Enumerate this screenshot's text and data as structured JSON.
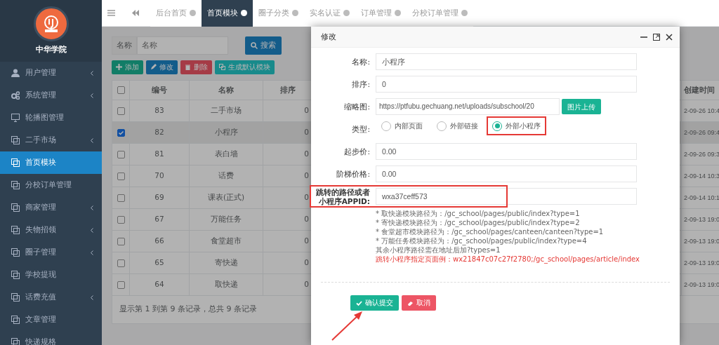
{
  "sidebar": {
    "school_name": "中华学院",
    "items": [
      {
        "label": "用户管理",
        "kind": "user",
        "has_children": true,
        "selected": false
      },
      {
        "label": "系统管理",
        "kind": "gears",
        "has_children": true,
        "selected": false
      },
      {
        "label": "轮播图管理",
        "kind": "monitor",
        "has_children": false,
        "selected": false
      },
      {
        "label": "二手市场",
        "kind": "copy",
        "has_children": true,
        "selected": false
      },
      {
        "label": "首页模块",
        "kind": "copy",
        "has_children": false,
        "selected": true
      },
      {
        "label": "分校订单管理",
        "kind": "copy",
        "has_children": false,
        "selected": false
      },
      {
        "label": "商家管理",
        "kind": "copy",
        "has_children": true,
        "selected": false
      },
      {
        "label": "失物招领",
        "kind": "copy",
        "has_children": true,
        "selected": false
      },
      {
        "label": "圈子管理",
        "kind": "copy",
        "has_children": true,
        "selected": false
      },
      {
        "label": "学校提现",
        "kind": "copy",
        "has_children": false,
        "selected": false
      },
      {
        "label": "话费充值",
        "kind": "copy",
        "has_children": true,
        "selected": false
      },
      {
        "label": "文章管理",
        "kind": "copy",
        "has_children": false,
        "selected": false
      },
      {
        "label": "快递规格",
        "kind": "copy",
        "has_children": false,
        "selected": false
      }
    ]
  },
  "tabs": [
    {
      "label": "后台首页",
      "selected": false
    },
    {
      "label": "首页模块",
      "selected": true
    },
    {
      "label": "圈子分类",
      "selected": false
    },
    {
      "label": "实名认证",
      "selected": false
    },
    {
      "label": "订单管理",
      "selected": false
    },
    {
      "label": "分校订单管理",
      "selected": false
    }
  ],
  "search": {
    "label": "名称",
    "placeholder": "名称",
    "button": "搜索"
  },
  "toolbar": [
    {
      "label": "添加",
      "kind": "add"
    },
    {
      "label": "修改",
      "kind": "edit"
    },
    {
      "label": "删除",
      "kind": "delete"
    },
    {
      "label": "生成默认模块",
      "kind": "generate"
    }
  ],
  "table": {
    "all_checked": false,
    "columns": [
      "编号",
      "名称",
      "排序",
      "创建时间"
    ],
    "rows": [
      {
        "selected": false,
        "cells": [
          "83",
          "二手市场",
          "0",
          "2-09-26 10:4"
        ]
      },
      {
        "selected": true,
        "cells": [
          "82",
          "小程序",
          "0",
          "2-09-26 09:4"
        ]
      },
      {
        "selected": false,
        "cells": [
          "81",
          "表白墙",
          "0",
          "2-09-26 09:3"
        ]
      },
      {
        "selected": false,
        "cells": [
          "70",
          "话费",
          "0",
          "2-09-14 10:3"
        ]
      },
      {
        "selected": false,
        "cells": [
          "69",
          "课表(正式)",
          "0",
          "2-09-14 10:1"
        ]
      },
      {
        "selected": false,
        "cells": [
          "67",
          "万能任务",
          "0",
          "2-09-13 19:0"
        ]
      },
      {
        "selected": false,
        "cells": [
          "66",
          "食堂超市",
          "0",
          "2-09-13 19:0"
        ]
      },
      {
        "selected": false,
        "cells": [
          "65",
          "寄快递",
          "0",
          "2-09-13 19:0"
        ]
      },
      {
        "selected": false,
        "cells": [
          "64",
          "取快递",
          "0",
          "2-09-13 19:0"
        ]
      }
    ],
    "footer": "显示第 1 到第 9 条记录，总共 9 条记录"
  },
  "modal": {
    "title": "修改",
    "fields": [
      {
        "kind": "text",
        "label": "名称:",
        "value": "小程序",
        "highlighted": false
      },
      {
        "kind": "text",
        "label": "排序:",
        "value": "0",
        "highlighted": false
      },
      {
        "kind": "upload",
        "label": "缩略图:",
        "value": "https://ptfubu.gechuang.net/uploads/subschool/20",
        "button": "图片上传",
        "highlighted": false
      },
      {
        "kind": "radio",
        "label": "类型:",
        "options": [
          {
            "label": "内部页面",
            "selected": false,
            "highlighted": false
          },
          {
            "label": "外部链接",
            "selected": false,
            "highlighted": false
          },
          {
            "label": "外部小程序",
            "selected": true,
            "highlighted": true
          }
        ]
      },
      {
        "kind": "text",
        "label": "起步价:",
        "value": "0.00",
        "highlighted": false
      },
      {
        "kind": "text",
        "label": "阶梯价格:",
        "value": "0.00",
        "highlighted": false
      },
      {
        "kind": "text",
        "label": "跳转的路径或者小程序APPID:",
        "value": "wxa37ceff573",
        "highlighted": true,
        "hints": [
          {
            "text": "* 取快递模块路径为：/gc_school/pages/public/index?type=1",
            "kind": "note"
          },
          {
            "text": "* 寄快递模块路径为：/gc_school/pages/public/index?type=2",
            "kind": "note"
          },
          {
            "text": "* 食堂超市模块路径为：/gc_school/pages/canteen/canteen?type=1",
            "kind": "note"
          },
          {
            "text": "* 万能任务模块路径为：/gc_school/pages/public/index?type=4",
            "kind": "note"
          },
          {
            "text": "其余小程序路径需在地址后加?types=1",
            "kind": "note"
          },
          {
            "text": "跳转小程序指定页面例：wx21847c07c27f2780;/gc_school/pages/article/index",
            "kind": "example"
          }
        ]
      }
    ],
    "buttons": [
      {
        "label": "确认提交",
        "kind": "submit"
      },
      {
        "label": "取消",
        "kind": "cancel"
      }
    ]
  }
}
